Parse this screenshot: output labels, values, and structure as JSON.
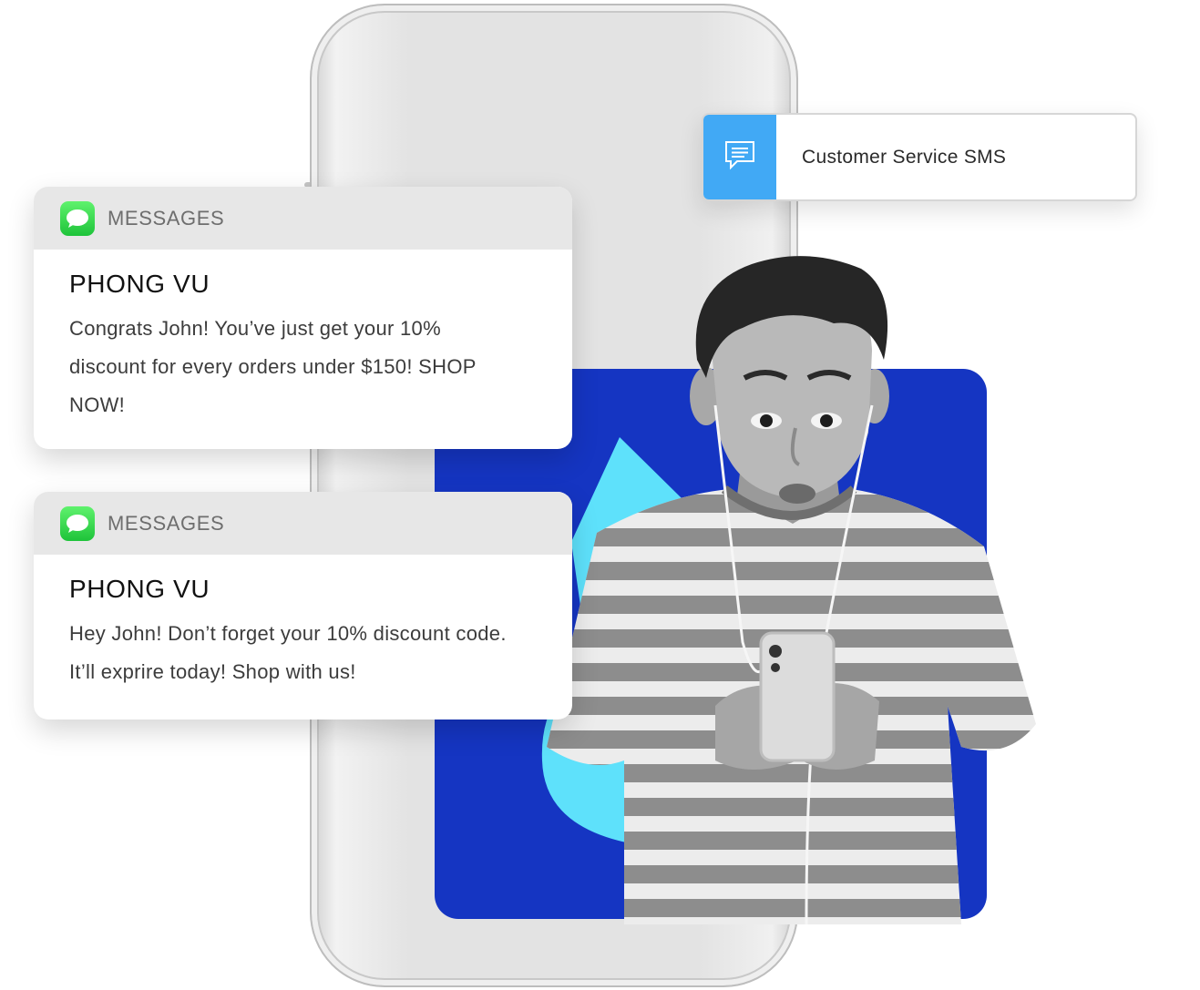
{
  "service_card": {
    "icon": "message-bubble-icon",
    "label": "Customer Service SMS",
    "icon_bg_color": "#41a9f5"
  },
  "notifications": [
    {
      "app_icon": "messages-app-icon",
      "app_name": "MESSAGES",
      "sender": "PHONG VU",
      "message": "Congrats John! You’ve just get your 10% discount for every orders under $150! SHOP NOW!"
    },
    {
      "app_icon": "messages-app-icon",
      "app_name": "MESSAGES",
      "sender": "PHONG VU",
      "message": "Hey John! Don’t forget your 10% discount code. It’ll exprire today! Shop with us!"
    }
  ],
  "colors": {
    "blue_backdrop": "#1535c2",
    "cyan_shape": "#5ee1fb",
    "messages_green": "#2bd04b"
  }
}
